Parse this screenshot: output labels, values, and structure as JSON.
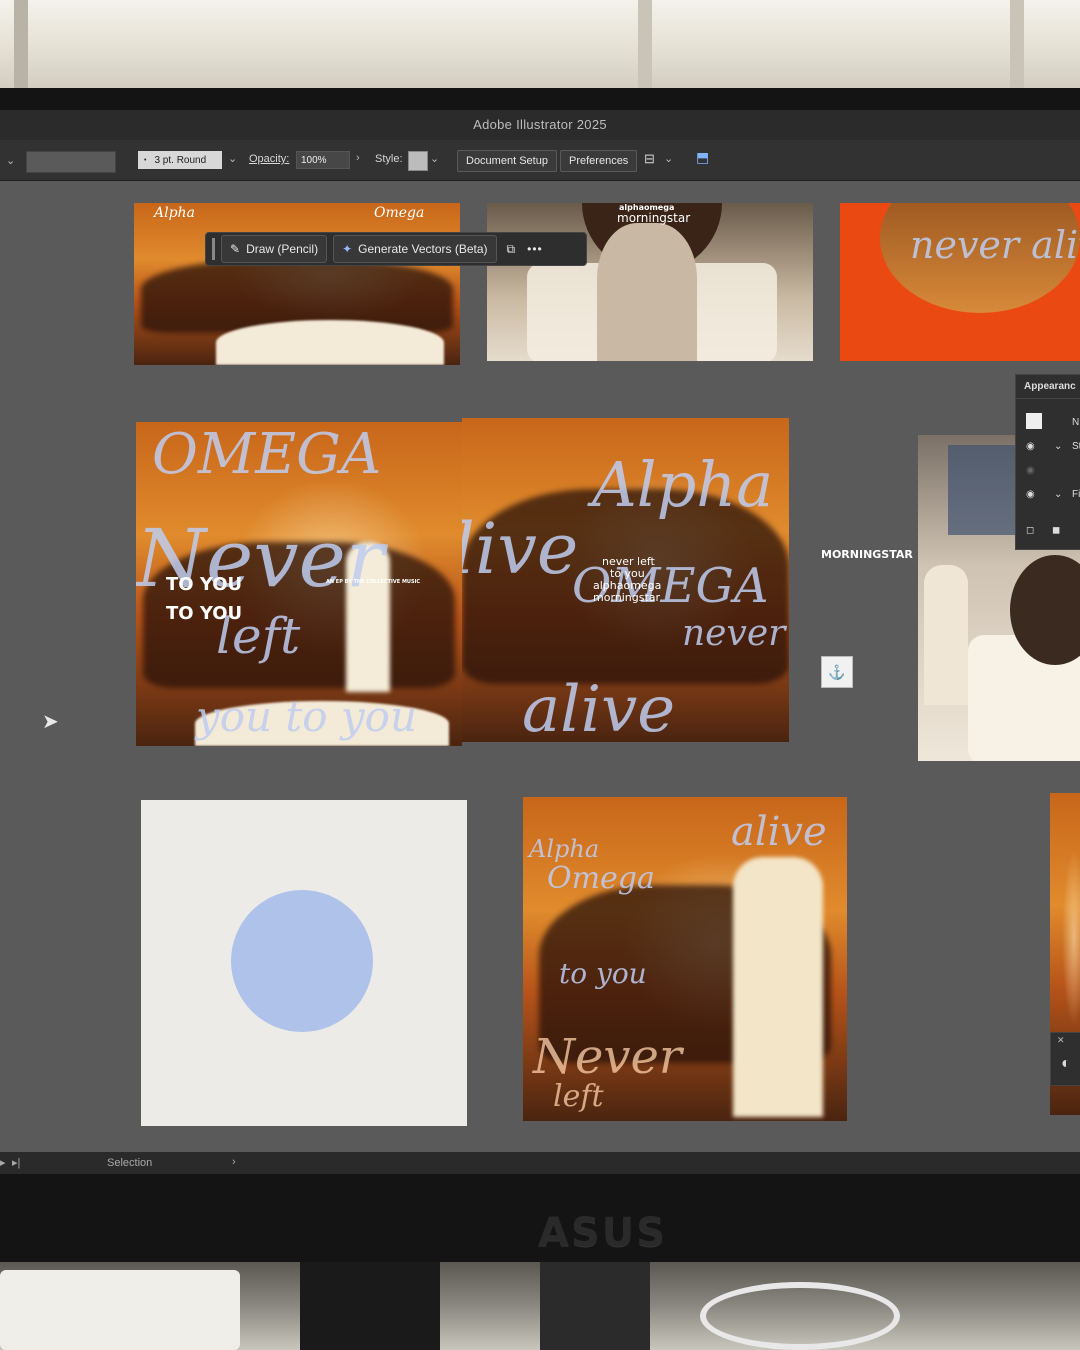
{
  "app": {
    "title": "Adobe Illustrator 2025"
  },
  "control_bar": {
    "stroke_weight": "3 pt. Round",
    "opacity_label": "Opacity:",
    "opacity_value": "100%",
    "style_label": "Style:",
    "document_setup": "Document Setup",
    "preferences": "Preferences"
  },
  "pencil_toolbar": {
    "draw_label": "Draw (Pencil)",
    "generate_label": "Generate Vectors (Beta)",
    "more_label": "•••"
  },
  "artboards": {
    "top_left": {
      "script_1": "Alpha",
      "script_2": "Omega"
    },
    "top_middle": {
      "text_1": "alphaomega",
      "text_2": "morningstar"
    },
    "top_right": {
      "scribble": "never alive left"
    },
    "mid_left": {
      "scribble_omega": "OMEGA",
      "scribble_never": "Never",
      "scribble_left": "left",
      "title_1": "TO YOU",
      "title_2": "TO YOU",
      "ep_line": "AN EP BY THE COLLECTIVE MUSIC",
      "scribble_bottom": "you to you"
    },
    "mid_center": {
      "scribble_alpha": "Alpha",
      "scribble_alive": "Alive",
      "scribble_omega": "OMEGA",
      "scribble_never": "never",
      "scribble_alive_bottom": "alive",
      "line_1": "never left",
      "line_2": "to you",
      "line_3": "alphaomega",
      "line_4": "morningstar"
    },
    "morningstar_label": "MORNINGSTAR",
    "bottom_right": {
      "scribble_alpha": "Alpha",
      "scribble_omega": "Omega",
      "scribble_alive": "alive",
      "scribble_toyou": "to you",
      "scribble_never": "Never",
      "scribble_left": "left"
    }
  },
  "appearance_panel": {
    "title": "Appearanc",
    "row_1": "N",
    "row_2": "St",
    "row_3": "Fi"
  },
  "status_bar": {
    "tool": "Selection"
  },
  "bezel": {
    "brand": "ASUS"
  },
  "colors": {
    "accent_orange": "#e0862c",
    "ui_dark": "#323232",
    "canvas": "#5a5a5a",
    "circle_blue": "#aec2ea",
    "scribble_blue": "#c4d2f2",
    "orange_artboard": "#ea4a12"
  }
}
